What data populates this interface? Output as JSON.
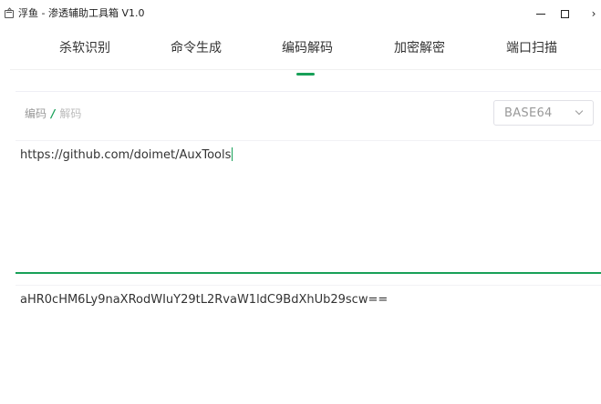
{
  "window": {
    "title": "浮鱼 - 渗透辅助工具箱 V1.0",
    "minimize_label": "–",
    "close_label": "›"
  },
  "tabs": [
    {
      "label": "杀软识别",
      "active": false
    },
    {
      "label": "命令生成",
      "active": false
    },
    {
      "label": "编码解码",
      "active": true
    },
    {
      "label": "加密解密",
      "active": false
    },
    {
      "label": "端口扫描",
      "active": false
    }
  ],
  "toolbar": {
    "mode_encode": "编码",
    "mode_slash": "/",
    "mode_decode": "解码",
    "algorithm": "BASE64"
  },
  "input": {
    "value": "https://github.com/doimet/AuxTools"
  },
  "output": {
    "value": "aHR0cHM6Ly9naXRodWIuY29tL2RvaW1ldC9BdXhUb29scw=="
  },
  "colors": {
    "accent": "#18a058",
    "text": "#333333",
    "muted": "#999999"
  }
}
